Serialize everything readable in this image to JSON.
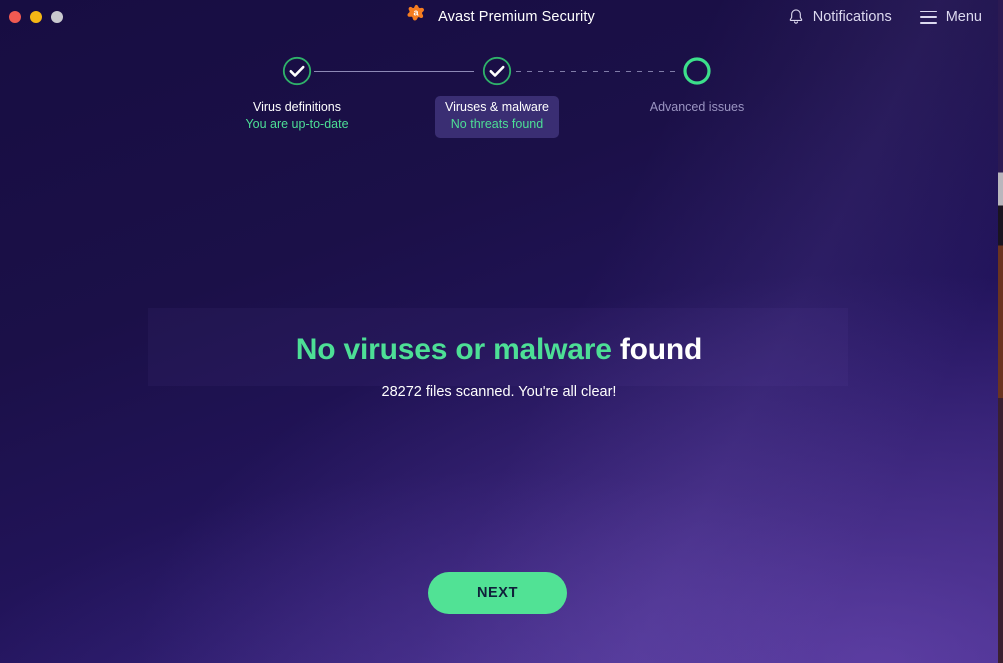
{
  "window": {
    "traffic_lights": [
      {
        "name": "close",
        "color": "#f05a52"
      },
      {
        "name": "minimize",
        "color": "#f5b715"
      },
      {
        "name": "zoom",
        "color": "#c9c9cf"
      }
    ]
  },
  "titlebar": {
    "brand_title": "Avast Premium Security",
    "brand_icon": "avast-logo-icon",
    "notifications": {
      "label": "Notifications",
      "icon": "bell-icon"
    },
    "menu": {
      "label": "Menu",
      "icon": "hamburger-icon"
    }
  },
  "stepper": {
    "steps": [
      {
        "title": "Virus definitions",
        "subtitle": "You are up-to-date",
        "state": "complete",
        "icon": "check-circle-icon",
        "highlighted": false
      },
      {
        "title": "Viruses & malware",
        "subtitle": "No threats found",
        "state": "complete",
        "icon": "check-circle-icon",
        "highlighted": true
      },
      {
        "title": "Advanced issues",
        "subtitle": "",
        "state": "pending",
        "icon": "ring-icon",
        "highlighted": false
      }
    ],
    "connectors": [
      {
        "style": "solid",
        "color": "#8d89b6"
      },
      {
        "style": "dashed",
        "color": "#807ca8"
      }
    ]
  },
  "hero": {
    "heading_accent": "No viruses or malware",
    "heading_plain": "found",
    "subtitle": "28272 files scanned. You're all clear!"
  },
  "actions": {
    "next_label": "NEXT"
  },
  "colors": {
    "accent_green": "#4ddf96",
    "button_green": "#51e295",
    "brand_orange": "#f57c20",
    "background_dark": "#170d42",
    "background_light": "#34207a",
    "muted_text": "#9b95c2"
  }
}
